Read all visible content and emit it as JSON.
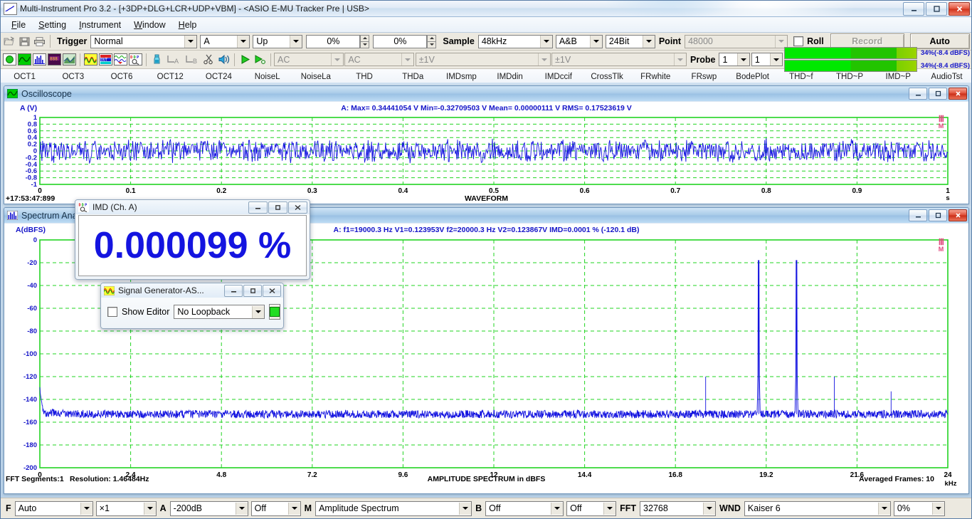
{
  "window": {
    "title": "Multi-Instrument Pro 3.2  -  [+3DP+DLG+LCR+UDP+VBM]  -  <ASIO E-MU Tracker Pre | USB>",
    "min": "–",
    "max": "❐",
    "close": "✕"
  },
  "menu": [
    "File",
    "Setting",
    "Instrument",
    "Window",
    "Help"
  ],
  "toolbar": {
    "trigger_label": "Trigger",
    "trigger_mode": "Normal",
    "trigger_source": "A",
    "trigger_slope": "Up",
    "trigger_level": "0%",
    "trigger_delay": "0%",
    "sample_label": "Sample",
    "sample_rate": "48kHz",
    "channels": "A&B",
    "bits": "24Bit",
    "point_label": "Point",
    "point_value": "48000",
    "roll_label": "Roll",
    "record_label": "Record",
    "auto_label": "Auto",
    "coupling_a": "AC",
    "coupling_b": "AC",
    "range_a": "±1V",
    "range_b": "±1V",
    "probe_label": "Probe",
    "probe_a": "1",
    "probe_b": "1",
    "meter_a_text": "34%(-8.4 dBFS)",
    "meter_b_text": "34%(-8.4 dBFS)"
  },
  "function_tabs": [
    "OCT1",
    "OCT3",
    "OCT6",
    "OCT12",
    "OCT24",
    "NoiseL",
    "NoiseLa",
    "THD",
    "THDa",
    "IMDsmp",
    "IMDdin",
    "IMDccif",
    "CrossTlk",
    "FRwhite",
    "FRswp",
    "BodePlot",
    "THD~f",
    "THD~P",
    "IMD~P",
    "AudioTst"
  ],
  "oscilloscope": {
    "title": "Oscilloscope",
    "y_axis_label": "A (V)",
    "stats": "A: Max= 0.34441054 V  Min=-0.32709503 V  Mean= 0.00000111 V  RMS= 0.17523619 V",
    "timestamp": "+17:53:47:899",
    "plot_name": "WAVEFORM",
    "x_unit": "s",
    "watermark": "M"
  },
  "spectrum": {
    "title": "Spectrum Ana",
    "y_axis_label": "A(dBFS)",
    "stats": "A: f1=19000.3 Hz  V1=0.123953V   f2=20000.3 Hz  V2=0.123867V   IMD=0.0001 % (-120.1 dB)",
    "fft_segments": "FFT Segments:1",
    "resolution": "Resolution: 1.46484Hz",
    "plot_name": "AMPLITUDE SPECTRUM in dBFS",
    "averaged_frames": "Averaged Frames: 10",
    "x_unit": "kHz",
    "watermark": "M"
  },
  "imd_dialog": {
    "title": "IMD (Ch. A)",
    "value": "0.000099 %"
  },
  "siggen_dialog": {
    "title": "Signal Generator-AS...",
    "show_editor_label": "Show Editor",
    "loopback": "No Loopback"
  },
  "statusbar": {
    "f_label": "F",
    "f_mode": "Auto",
    "f_mult": "×1",
    "a_label": "A",
    "a_range": "-200dB",
    "a_opt": "Off",
    "m_label": "M",
    "m_mode": "Amplitude Spectrum",
    "b_label": "B",
    "b_opt1": "Off",
    "b_opt2": "Off",
    "fft_label": "FFT",
    "fft_size": "32768",
    "wnd_label": "WND",
    "window": "Kaiser 6",
    "overlap": "0%"
  },
  "colors": {
    "trace": "#1414e0",
    "grid": "#22d422",
    "axis_text": "#1414c8",
    "accent": "#e0457b"
  },
  "chart_data": [
    {
      "type": "line",
      "title": "WAVEFORM",
      "xlabel": "s",
      "ylabel": "A (V)",
      "xlim": [
        0,
        1
      ],
      "ylim": [
        -1,
        1
      ],
      "xticks": [
        "0",
        "0.1",
        "0.2",
        "0.3",
        "0.4",
        "0.5",
        "0.6",
        "0.7",
        "0.8",
        "0.9",
        "1"
      ],
      "yticks": [
        "1",
        "0.8",
        "0.6",
        "0.4",
        "0.2",
        "0",
        "-0.2",
        "-0.4",
        "-0.6",
        "-0.8",
        "-1"
      ],
      "grid": true,
      "series": [
        {
          "name": "A",
          "description": "dense noise-like band, peak 0.344 V, min -0.327 V, RMS 0.175 V"
        }
      ],
      "annotations": [
        "A: Max= 0.34441054 V",
        "Min=-0.32709503 V",
        "Mean= 0.00000111 V",
        "RMS= 0.17523619 V"
      ]
    },
    {
      "type": "line",
      "title": "AMPLITUDE SPECTRUM in dBFS",
      "xlabel": "kHz",
      "ylabel": "A(dBFS)",
      "xlim": [
        0,
        24
      ],
      "ylim": [
        -200,
        0
      ],
      "xticks": [
        "0",
        "2.4",
        "4.8",
        "7.2",
        "9.6",
        "12",
        "14.4",
        "16.8",
        "19.2",
        "21.6",
        "24"
      ],
      "yticks": [
        "0",
        "-20",
        "-40",
        "-60",
        "-80",
        "-100",
        "-120",
        "-140",
        "-160",
        "-180",
        "-200"
      ],
      "grid": true,
      "noise_floor_db": -153,
      "peaks": [
        {
          "freq_khz": 17.6,
          "level_db": -120
        },
        {
          "freq_khz": 19.0,
          "level_db": -18
        },
        {
          "freq_khz": 20.0,
          "level_db": -18
        },
        {
          "freq_khz": 21.0,
          "level_db": -120
        },
        {
          "freq_khz": 22.5,
          "level_db": -133
        }
      ],
      "annotations": [
        "f1=19000.3 Hz",
        "V1=0.123953V",
        "f2=20000.3 Hz",
        "V2=0.123867V",
        "IMD=0.0001 % (-120.1 dB)",
        "FFT Segments:1",
        "Resolution: 1.46484Hz",
        "Averaged Frames: 10"
      ]
    }
  ]
}
